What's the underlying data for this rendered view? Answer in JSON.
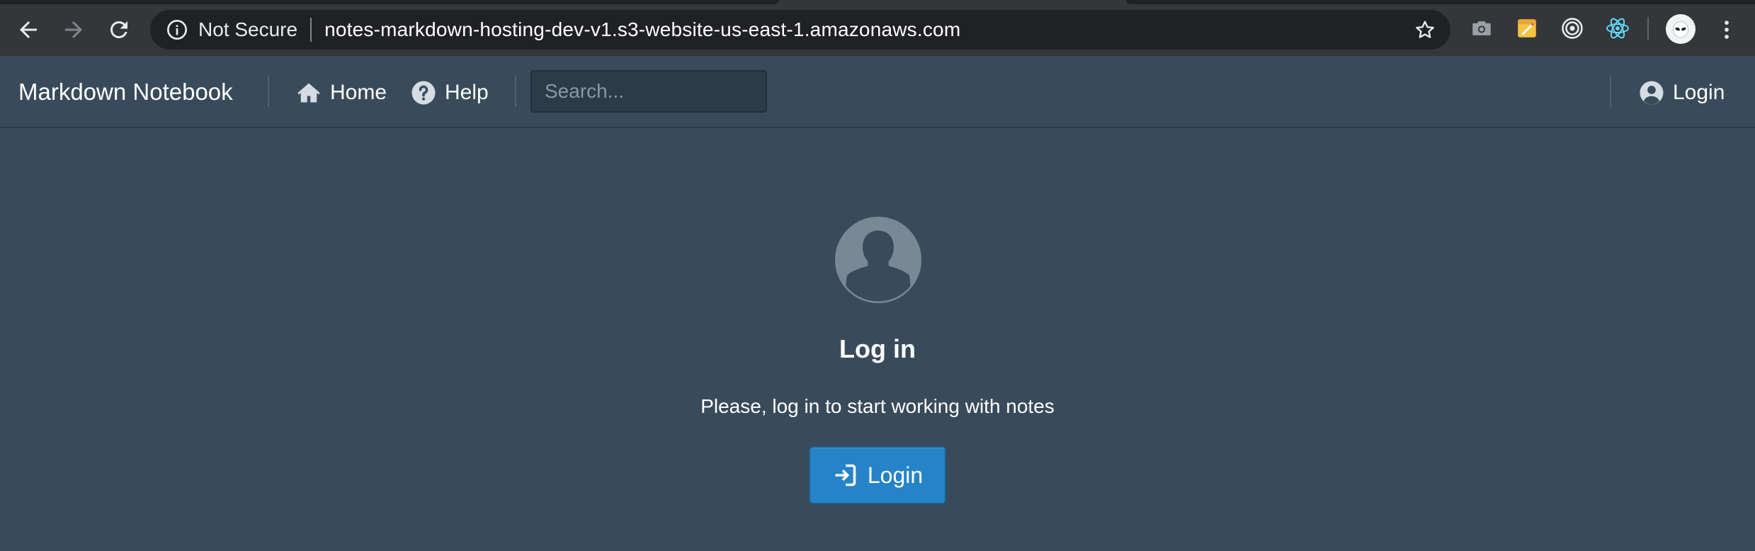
{
  "browser": {
    "security_label": "Not Secure",
    "url": "notes-markdown-hosting-dev-v1.s3-website-us-east-1.amazonaws.com",
    "icons": {
      "back": "back-arrow-icon",
      "forward": "forward-arrow-icon",
      "reload": "reload-icon",
      "info": "info-icon",
      "bookmark": "star-icon",
      "extensions": [
        "camera-icon",
        "notes-extension-icon",
        "target-icon",
        "react-icon"
      ],
      "profile": "profile-avatar-icon",
      "menu": "kebab-menu-icon"
    }
  },
  "navbar": {
    "brand": "Markdown Notebook",
    "home_label": "Home",
    "help_label": "Help",
    "search_placeholder": "Search...",
    "search_value": "",
    "login_label": "Login"
  },
  "main": {
    "heading": "Log in",
    "message": "Please, log in to start working with notes",
    "login_button_label": "Login"
  },
  "colors": {
    "page_bg": "#394b5b",
    "browser_bar": "#35363a",
    "omnibox_bg": "#202124",
    "primary_button": "#2583c7",
    "avatar_gray": "#7a8896"
  }
}
